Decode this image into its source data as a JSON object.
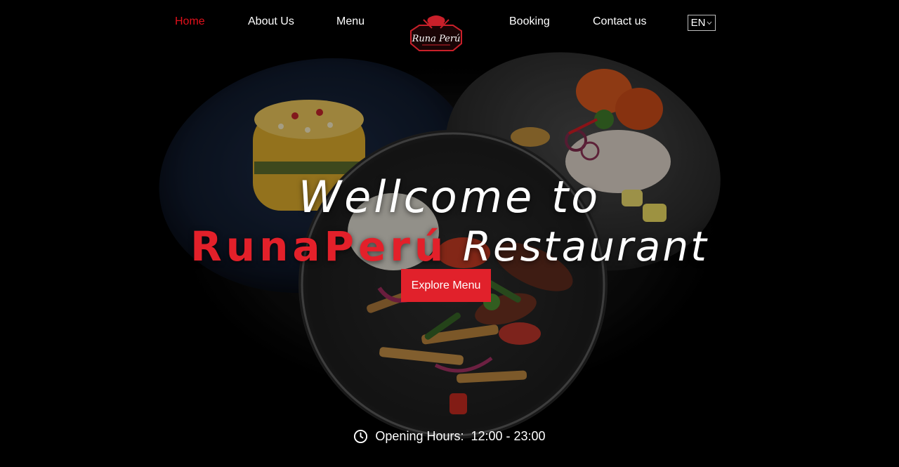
{
  "nav": {
    "items": [
      {
        "label": "Home",
        "active": true
      },
      {
        "label": "About Us"
      },
      {
        "label": "Menu"
      },
      {
        "label": "Booking"
      },
      {
        "label": "Contact us"
      }
    ],
    "logo": {
      "text": "Runa Perú",
      "icon": "chef-hat-crossed-knives-logo"
    },
    "language": {
      "value": "EN",
      "icon": "chevron-down-icon"
    }
  },
  "hero": {
    "line1": "Wellcome to",
    "brand": "RunaPerú",
    "rest": "Restaurant",
    "cta_label": "Explore Menu",
    "hours": {
      "icon": "clock-icon",
      "label": "Opening Hours:",
      "value": "12:00 - 23:00"
    }
  },
  "colors": {
    "accent": "#e3101b",
    "button": "#e1212b",
    "background": "#000000"
  }
}
